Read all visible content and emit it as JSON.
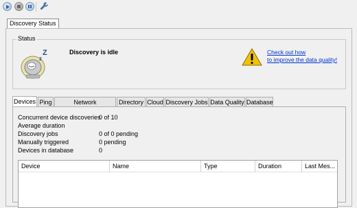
{
  "toolbar": {
    "buttons": [
      {
        "name": "start",
        "icon": "play-icon"
      },
      {
        "name": "stop",
        "icon": "stop-icon"
      },
      {
        "name": "pause",
        "icon": "pause-icon"
      },
      {
        "name": "settings",
        "icon": "wrench-icon"
      }
    ]
  },
  "top_tab": {
    "label": "Discovery Status"
  },
  "status": {
    "group_label": "Status",
    "message": "Discovery is idle",
    "link_line1": "Check out how",
    "link_line2": "to improve the data quality!",
    "mascot_icon": "sleeping-mascot-icon",
    "warning_icon": "warning-icon"
  },
  "tabs": [
    {
      "label": "Devices",
      "active": true
    },
    {
      "label": "Ping"
    },
    {
      "label": "Network Neighborhood"
    },
    {
      "label": "Directory"
    },
    {
      "label": "Cloud"
    },
    {
      "label": "Discovery Jobs"
    },
    {
      "label": "Data Quality"
    },
    {
      "label": "Database"
    }
  ],
  "devices": {
    "stats": [
      {
        "label": "Concurrent device discoveries",
        "value": "0 of 10"
      },
      {
        "label": "Average duration",
        "value": ""
      },
      {
        "label": "Discovery jobs",
        "value": "0 of 0 pending"
      },
      {
        "label": "Manually triggered",
        "value": "0 pending"
      },
      {
        "label": "Devices in database",
        "value": "0"
      }
    ],
    "columns": [
      "Device",
      "Name",
      "Type",
      "Duration",
      "Last Mes..."
    ]
  },
  "colors": {
    "link": "#0033cc",
    "warning": "#f2c200",
    "accent": "#2f5f9a"
  }
}
